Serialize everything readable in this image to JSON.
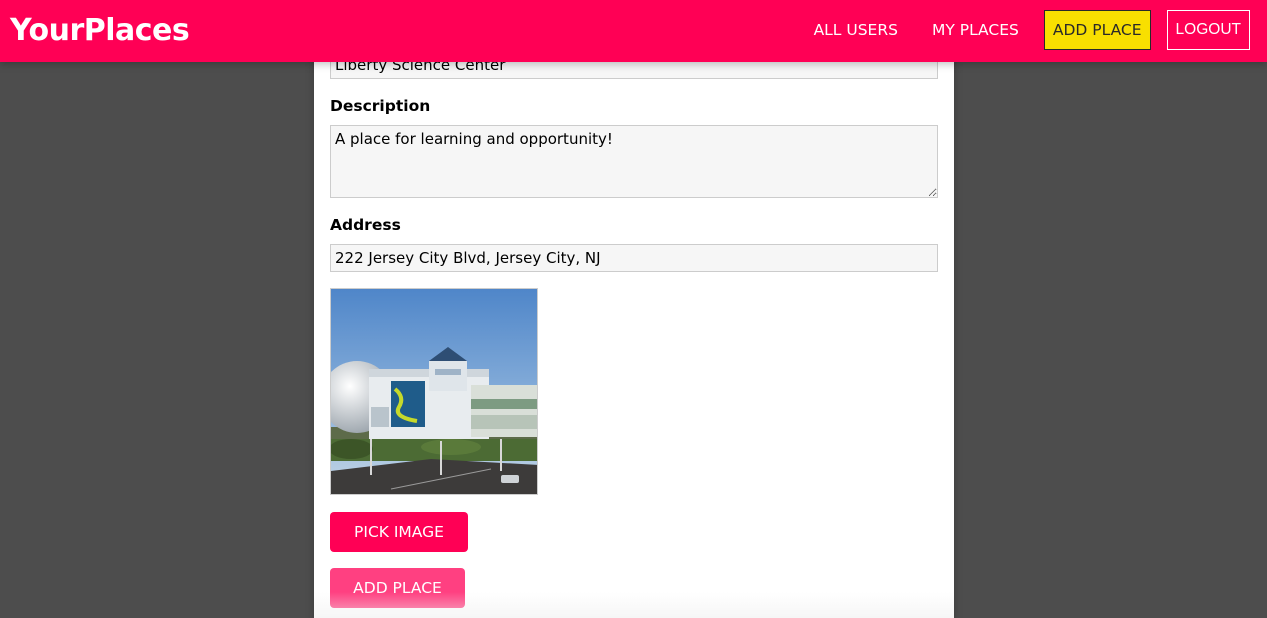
{
  "header": {
    "brand": "YourPlaces",
    "nav": {
      "all_users": "ALL USERS",
      "my_places": "MY PLACES",
      "add_place": "ADD PLACE",
      "logout": "LOGOUT"
    }
  },
  "form": {
    "title_value": "Liberty Science Center",
    "description_label": "Description",
    "description_value": "A place for learning and opportunity!",
    "address_label": "Address",
    "address_value": "222 Jersey City Blvd, Jersey City, NJ",
    "pick_image_label": "PICK IMAGE",
    "submit_label": "ADD PLACE"
  },
  "colors": {
    "header_bg": "#ff0055",
    "active_nav_bg": "#f8df00",
    "backdrop": "#4d4d4d",
    "pick_button": "#ff0055",
    "submit_button": "#ff4081"
  }
}
